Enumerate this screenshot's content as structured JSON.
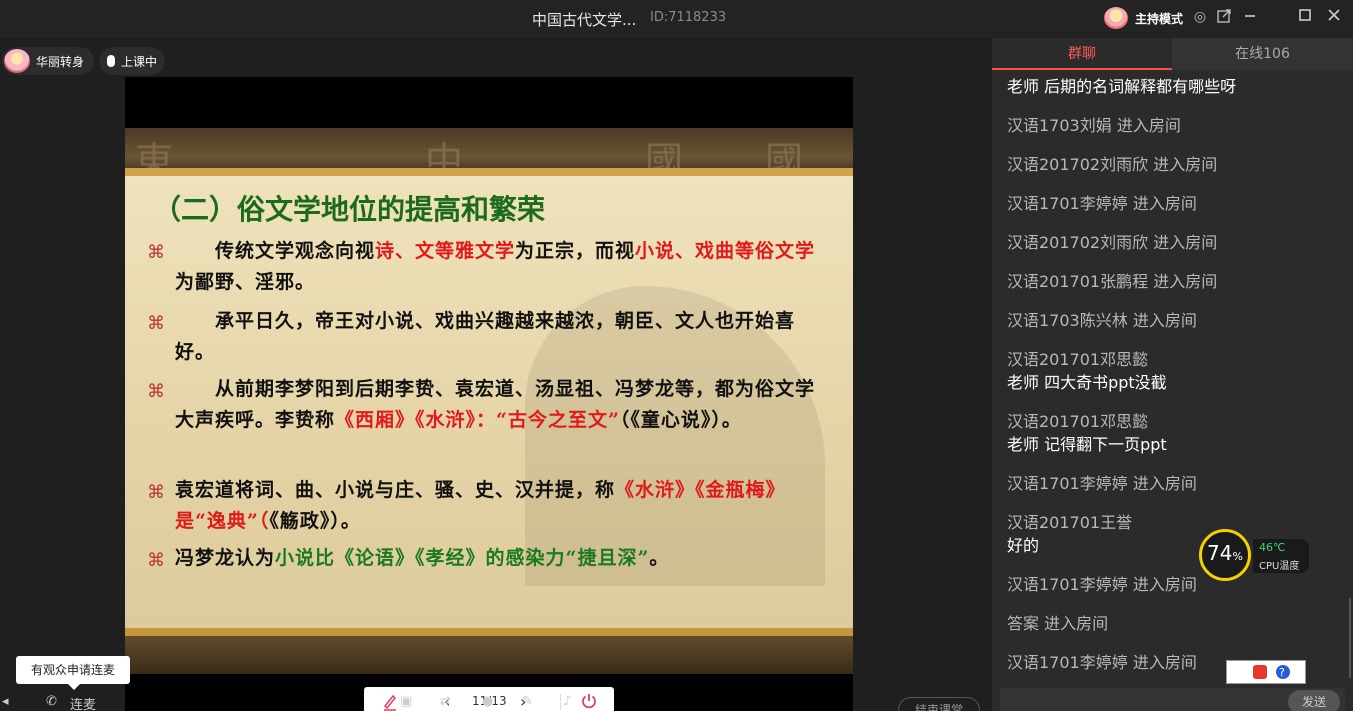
{
  "window": {
    "title": "中国古代文学...",
    "room_id": "ID:7118233",
    "host_mode_label": "主持模式",
    "controls": [
      "target-icon",
      "popout-icon",
      "minimize-icon",
      "maximize-icon",
      "close-icon"
    ]
  },
  "presenter": {
    "name": "华丽转身",
    "status": "上课中"
  },
  "slide": {
    "heading": "（二）俗文学地位的提高和繁荣",
    "bullet_symbol": "⌘",
    "paragraphs": [
      {
        "parts": [
          {
            "text": "　　传统文学观念向视",
            "style": "normal"
          },
          {
            "text": "诗、文等雅文学",
            "style": "red"
          },
          {
            "text": "为正宗，而视",
            "style": "normal"
          },
          {
            "text": "小说、戏曲等俗文学",
            "style": "red"
          },
          {
            "text": "为鄙野、淫邪。",
            "style": "normal"
          }
        ]
      },
      {
        "parts": [
          {
            "text": "　　承平日久，帝王对小说、戏曲兴趣越来越浓，朝臣、文人也开始喜好。",
            "style": "normal"
          }
        ]
      },
      {
        "parts": [
          {
            "text": "　　从前期李梦阳到后期李贽、袁宏道、汤显祖、冯梦龙等，都为俗文学大声疾呼。李贽称",
            "style": "normal"
          },
          {
            "text": "《西厢》《水浒》：“古今之至文”",
            "style": "red"
          },
          {
            "text": "（《童心说》）。",
            "style": "normal"
          }
        ]
      },
      {
        "parts": [
          {
            "text": "袁宏道将词、曲、小说与庄、骚、史、汉并提，称",
            "style": "normal"
          },
          {
            "text": "《水浒》《金瓶梅》是“逸典”（",
            "style": "red"
          },
          {
            "text": "《觞政》）。",
            "style": "normal"
          }
        ]
      },
      {
        "parts": [
          {
            "text": "冯梦龙认为",
            "style": "normal"
          },
          {
            "text": "小说比《论语》《孝经》的感染力“捷且深”",
            "style": "green"
          },
          {
            "text": "。",
            "style": "normal"
          }
        ]
      }
    ],
    "decor_chars": [
      "東",
      "中",
      "國",
      "國"
    ]
  },
  "pager": {
    "current": "11/13"
  },
  "tooltip": {
    "text": "有观众申请连麦"
  },
  "bottom_bar": {
    "connect_label": "连麦",
    "end_class_label": "结束课堂"
  },
  "chat": {
    "tab_group": "群聊",
    "tab_online": "在线106",
    "messages": [
      {
        "sender": "",
        "text": "老师  后期的名词解释都有哪些呀",
        "white": true
      },
      {
        "sender": "汉语1703刘娟",
        "text": "进入房间"
      },
      {
        "sender": "汉语201702刘雨欣",
        "text": "进入房间"
      },
      {
        "sender": "汉语1701李婷婷",
        "text": "进入房间"
      },
      {
        "sender": "汉语201702刘雨欣",
        "text": "进入房间"
      },
      {
        "sender": "汉语201701张鹏程",
        "text": "进入房间"
      },
      {
        "sender": "汉语1703陈兴林",
        "text": "进入房间"
      },
      {
        "sender": "汉语201701邓思懿",
        "text": "",
        "reply": "老师 四大奇书ppt没截"
      },
      {
        "sender": "汉语201701邓思懿",
        "text": "",
        "reply": "老师 记得翻下一页ppt"
      },
      {
        "sender": "汉语1701李婷婷",
        "text": "进入房间"
      },
      {
        "sender": "汉语201701王誉",
        "text": "",
        "reply": "好的"
      },
      {
        "sender": "汉语1701李婷婷",
        "text": "进入房间"
      },
      {
        "sender": "答案",
        "text": "进入房间"
      },
      {
        "sender": "汉语1701李婷婷",
        "text": "进入房间"
      }
    ],
    "send_label": "发送"
  },
  "cpu_widget": {
    "usage": "74",
    "usage_unit": "%",
    "temperature": "46℃",
    "label": "CPU温度"
  },
  "colors": {
    "accent": "#ff4d4d",
    "heading_green": "#1c6b1c",
    "highlight_red": "#e01a1a",
    "cpu_ring": "#f5d000"
  }
}
